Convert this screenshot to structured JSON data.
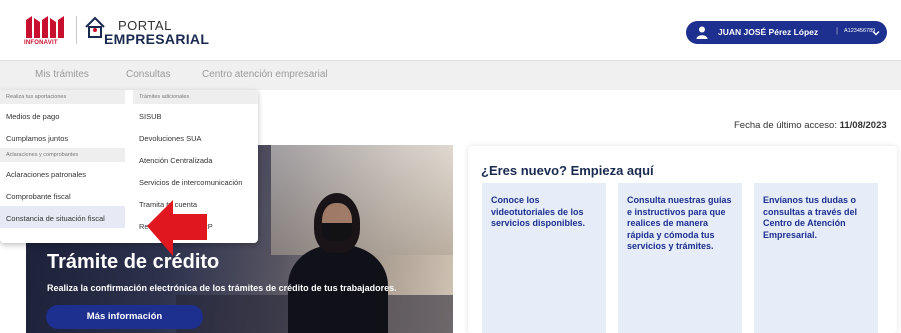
{
  "header": {
    "infonavit_text": "INFONAVIT",
    "portal_line1": "PORTAL",
    "portal_line2": "EMPRESARIAL"
  },
  "user": {
    "name": "JUAN JOSÉ Pérez López",
    "separator": "|",
    "id": "A123456789",
    "icon": "user-icon",
    "chevron": "chevron-down-icon"
  },
  "nav": {
    "items": [
      "Mis trámites",
      "Consultas",
      "Centro atención empresarial"
    ]
  },
  "dropdown": {
    "col1": {
      "head1": "Realiza tus aportaciones",
      "items1": [
        "Medios de pago",
        "Cumplamos juntos"
      ],
      "head2": "Aclaraciones y comprobantes",
      "items2": [
        "Aclaraciones patronales",
        "Comprobante fiscal",
        "Constancia de situación fiscal"
      ]
    },
    "col2": {
      "head": "Trámites adicionales",
      "items": [
        "SISUB",
        "Devoluciones SUA",
        "Atención Centralizada",
        "Servicios de intercomunicación",
        "Tramita tu cuenta",
        "Reasignación de NRP"
      ]
    }
  },
  "last_access": {
    "label": "Fecha de último acceso:",
    "date": "11/08/2023"
  },
  "hero": {
    "title": "Trámite de crédito",
    "subtitle": "Realiza la confirmación electrónica de los trámites de crédito de tus trabajadores.",
    "button": "Más información"
  },
  "card": {
    "title": "¿Eres nuevo? Empieza aquí",
    "boxes": [
      "Conoce los videotutoriales de los servicios disponibles.",
      "Consulta nuestras guías e instructivos para que realices de manera rápida y cómoda tus servicios y trámites.",
      "Envíanos tus dudas o consultas a través del Centro de Atención Empresarial."
    ]
  },
  "colors": {
    "brand_blue": "#1d2f8f",
    "infonavit_red": "#c8102e",
    "arrow_red": "#e0171f"
  }
}
